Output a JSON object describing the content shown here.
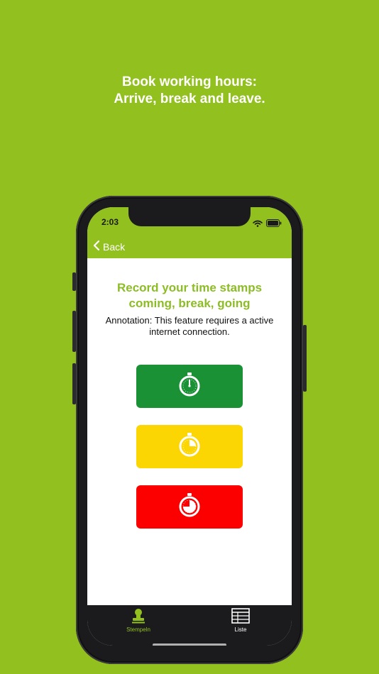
{
  "headline": {
    "line1": "Book working hours:",
    "line2": "Arrive, break and leave."
  },
  "status_bar": {
    "time": "2:03"
  },
  "nav": {
    "back_label": "Back"
  },
  "content": {
    "title_line1": "Record your time stamps",
    "title_line2": "coming, break, going",
    "note_line1": "Annotation: This feature requires a active",
    "note_line2": "internet connection."
  },
  "buttons": [
    {
      "name": "coming",
      "color": "#1a9135",
      "icon": "stopwatch-icon"
    },
    {
      "name": "break",
      "color": "#fcd602",
      "icon": "stopwatch-quarter-icon"
    },
    {
      "name": "going",
      "color": "#fc0000",
      "icon": "stopwatch-three-quarter-icon"
    }
  ],
  "tabbar": {
    "tabs": [
      {
        "label": "Stempeln",
        "icon": "stamp-icon",
        "active": true
      },
      {
        "label": "Liste",
        "icon": "table-icon",
        "active": false
      }
    ]
  },
  "colors": {
    "background": "#92c01f",
    "accent": "#8dbd26",
    "tab_active": "#92c01f",
    "tab_inactive": "#ffffff"
  }
}
